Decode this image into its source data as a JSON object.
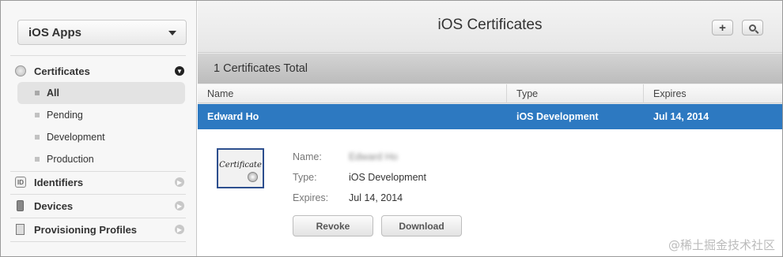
{
  "sidebar": {
    "platform": "iOS Apps",
    "sections": [
      {
        "label": "Certificates",
        "icon": "certificate-icon"
      },
      {
        "label": "Identifiers",
        "icon": "id-badge-icon"
      },
      {
        "label": "Devices",
        "icon": "iphone-icon"
      },
      {
        "label": "Provisioning Profiles",
        "icon": "profile-document-icon"
      }
    ],
    "certificate_filters": [
      "All",
      "Pending",
      "Development",
      "Production"
    ],
    "active_filter": "All"
  },
  "header": {
    "title": "iOS Certificates",
    "add_button": "+",
    "search_button": "search-icon"
  },
  "count_bar": {
    "text": "1 Certificates Total"
  },
  "table": {
    "columns": [
      "Name",
      "Type",
      "Expires"
    ],
    "rows": [
      {
        "name": "Edward Ho",
        "type": "iOS Development",
        "expires": "Jul 14, 2014"
      }
    ]
  },
  "detail": {
    "image_text": "Certificate",
    "labels": {
      "name": "Name:",
      "type": "Type:",
      "expires": "Expires:"
    },
    "values": {
      "name": "Edward Ho",
      "type": "iOS Development",
      "expires": "Jul 14, 2014"
    },
    "buttons": {
      "revoke": "Revoke",
      "download": "Download"
    }
  },
  "watermark": "@稀土掘金技术社区",
  "colors": {
    "selection": "#2d79c1",
    "count_bar": "#c8c8c8"
  }
}
